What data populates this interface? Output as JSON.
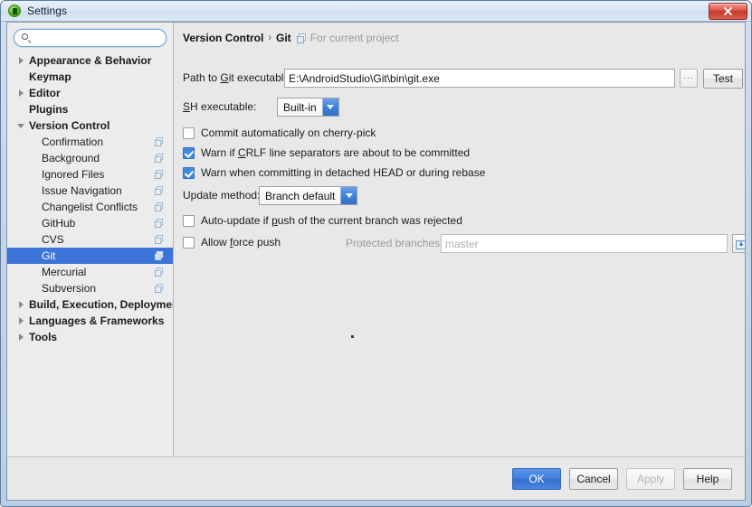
{
  "window": {
    "title": "Settings",
    "app_icon": "android-studio-icon",
    "close_label": "✕"
  },
  "sidebar": {
    "search": {
      "value": "",
      "placeholder": "",
      "icon": "search-icon"
    },
    "items": [
      {
        "label": "Appearance & Behavior",
        "level": 0,
        "bold": true,
        "arrow": "right",
        "selected": false,
        "project_icon": false
      },
      {
        "label": "Keymap",
        "level": 0,
        "bold": true,
        "arrow": "none",
        "selected": false,
        "project_icon": false
      },
      {
        "label": "Editor",
        "level": 0,
        "bold": true,
        "arrow": "right",
        "selected": false,
        "project_icon": false
      },
      {
        "label": "Plugins",
        "level": 0,
        "bold": true,
        "arrow": "none",
        "selected": false,
        "project_icon": false
      },
      {
        "label": "Version Control",
        "level": 0,
        "bold": true,
        "arrow": "down",
        "selected": false,
        "project_icon": false
      },
      {
        "label": "Confirmation",
        "level": 1,
        "bold": false,
        "arrow": "none",
        "selected": false,
        "project_icon": true
      },
      {
        "label": "Background",
        "level": 1,
        "bold": false,
        "arrow": "none",
        "selected": false,
        "project_icon": true
      },
      {
        "label": "Ignored Files",
        "level": 1,
        "bold": false,
        "arrow": "none",
        "selected": false,
        "project_icon": true
      },
      {
        "label": "Issue Navigation",
        "level": 1,
        "bold": false,
        "arrow": "none",
        "selected": false,
        "project_icon": true
      },
      {
        "label": "Changelist Conflicts",
        "level": 1,
        "bold": false,
        "arrow": "none",
        "selected": false,
        "project_icon": true
      },
      {
        "label": "GitHub",
        "level": 1,
        "bold": false,
        "arrow": "none",
        "selected": false,
        "project_icon": true
      },
      {
        "label": "CVS",
        "level": 1,
        "bold": false,
        "arrow": "none",
        "selected": false,
        "project_icon": true
      },
      {
        "label": "Git",
        "level": 1,
        "bold": false,
        "arrow": "none",
        "selected": true,
        "project_icon": true
      },
      {
        "label": "Mercurial",
        "level": 1,
        "bold": false,
        "arrow": "none",
        "selected": false,
        "project_icon": true
      },
      {
        "label": "Subversion",
        "level": 1,
        "bold": false,
        "arrow": "none",
        "selected": false,
        "project_icon": true
      },
      {
        "label": "Build, Execution, Deployment",
        "level": 0,
        "bold": true,
        "arrow": "right",
        "selected": false,
        "project_icon": false
      },
      {
        "label": "Languages & Frameworks",
        "level": 0,
        "bold": true,
        "arrow": "right",
        "selected": false,
        "project_icon": false
      },
      {
        "label": "Tools",
        "level": 0,
        "bold": true,
        "arrow": "right",
        "selected": false,
        "project_icon": false
      }
    ]
  },
  "breadcrumb": {
    "root": "Version Control",
    "separator": "›",
    "leaf": "Git",
    "scope_note": "For current project",
    "scope_icon": "project-scope-icon"
  },
  "form": {
    "git_path": {
      "label_pre": "Path to ",
      "label_mnemonic": "G",
      "label_post": "it executable:",
      "value": "E:\\AndroidStudio\\Git\\bin\\git.exe",
      "browse_label": "...",
      "test_label": "Test"
    },
    "ssh": {
      "label_mnemonic": "S",
      "label_post": "SH executable:",
      "value": "Built-in"
    },
    "cherry_pick": {
      "label": "Commit automatically on cherry-pick",
      "checked": false
    },
    "crlf_warn": {
      "label_pre": "Warn if ",
      "label_mnemonic": "C",
      "label_post": "RLF line separators are about to be committed",
      "checked": true
    },
    "detached_head_warn": {
      "label": "Warn when committing in detached HEAD or during rebase",
      "checked": true
    },
    "update_method": {
      "label": "Update method:",
      "value": "Branch default"
    },
    "auto_update": {
      "label_pre": "Auto-update if ",
      "label_mnemonic": "p",
      "label_post": "ush of the current branch was rejected",
      "checked": false
    },
    "allow_force_push": {
      "label_pre": "Allow ",
      "label_mnemonic": "f",
      "label_post": "orce push",
      "checked": false
    },
    "protected_branches": {
      "label": "Protected branches:",
      "value": "master",
      "enabled": false,
      "expand_icon": "expand-field-icon"
    }
  },
  "footer": {
    "ok": "OK",
    "cancel": "Cancel",
    "apply": "Apply",
    "apply_enabled": false,
    "help": "Help"
  },
  "colors": {
    "selection_blue": "#3c74d8",
    "checkbox_blue": "#3f8ae0",
    "primary_button": "#3f7ddc",
    "close_red": "#c43a2c",
    "panel_bg": "#e8e8e8",
    "sidebar_bg": "#ececec"
  }
}
